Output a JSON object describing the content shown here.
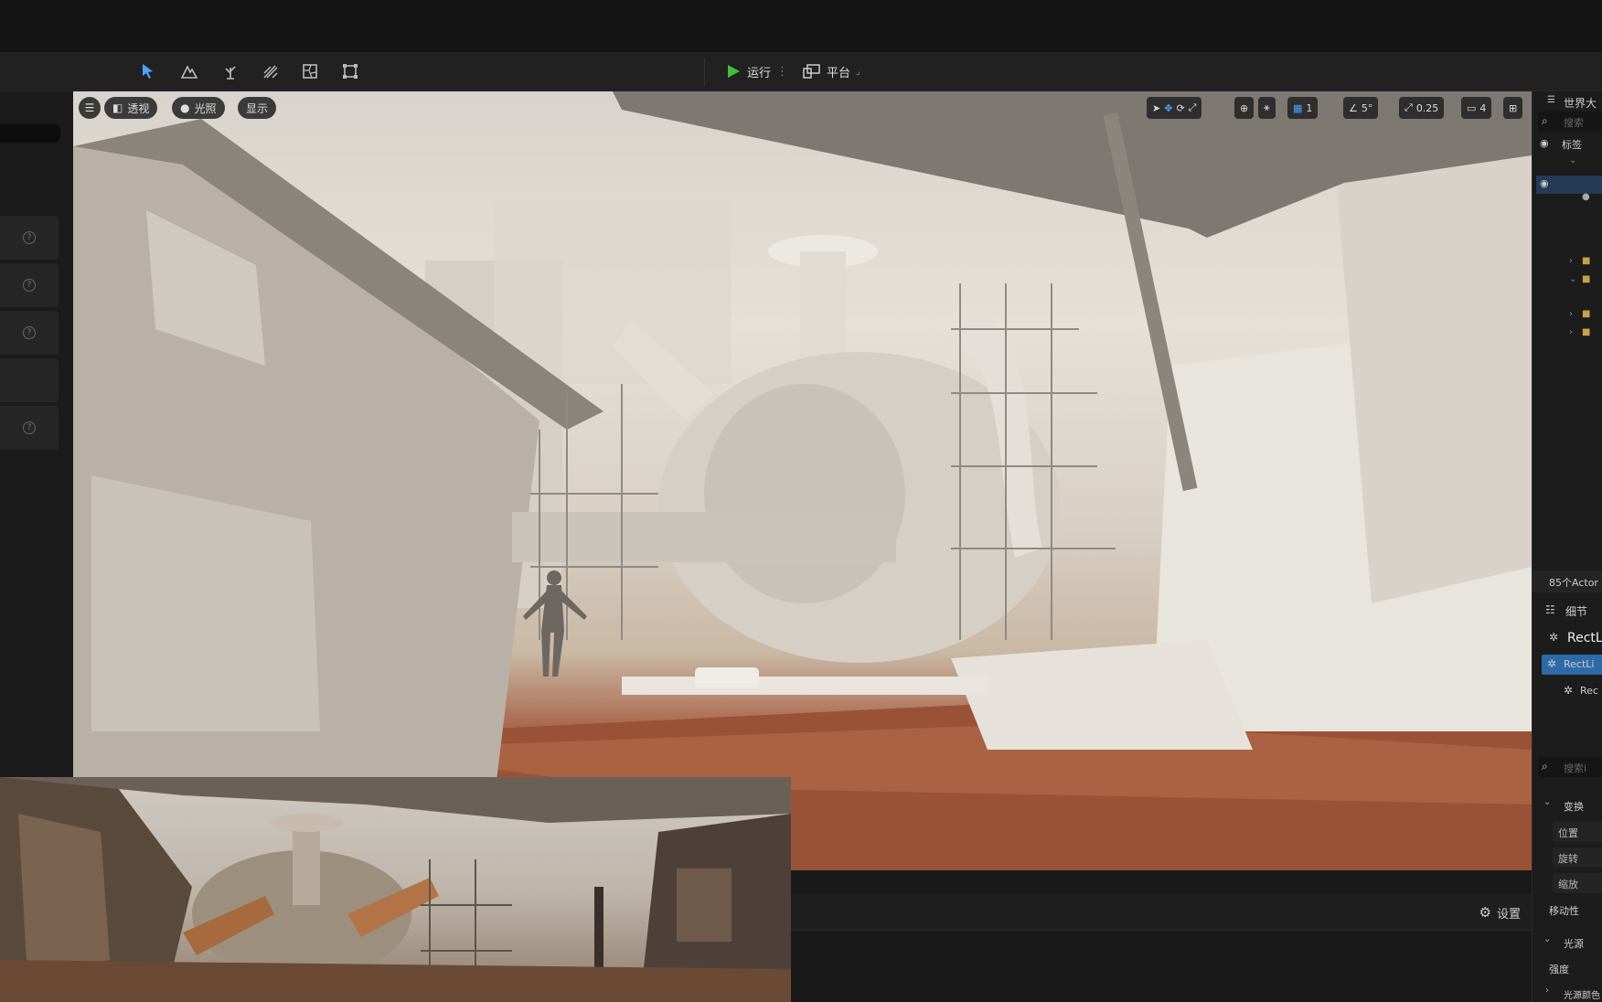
{
  "toolbar": {
    "mode_icons": [
      "select-mode-icon",
      "landscape-mode-icon",
      "foliage-mode-icon",
      "mesh-paint-mode-icon",
      "fracture-mode-icon",
      "modeling-mode-icon"
    ],
    "play_label": "运行",
    "platform_label": "平台"
  },
  "viewport": {
    "perspective_label": "透视",
    "lighting_label": "光照",
    "show_label": "显示",
    "grid_snap": "1",
    "rotation_snap": "5°",
    "scale_snap": "0.25",
    "camera_speed": "4"
  },
  "bottom_panel": {
    "settings_label": "设置"
  },
  "outliner": {
    "title": "世界大",
    "search_placeholder": "搜索",
    "label_column": "标签",
    "actor_count": "85个Actor"
  },
  "details": {
    "title": "细节",
    "selected_name": "RectL",
    "component_1": "RectLi",
    "component_2": "Rec",
    "search_placeholder": "搜索i",
    "transform_section": "变换",
    "location_label": "位置",
    "rotation_label": "旋转",
    "scale_label": "缩放",
    "mobility_label": "移动性",
    "light_section": "光源",
    "intensity_label": "强度",
    "light_color_label": "光源颜色"
  },
  "colors": {
    "accent_green": "#3fbf3f",
    "selection_blue": "#2f6aa8",
    "ground_orange": "#9a5236"
  }
}
